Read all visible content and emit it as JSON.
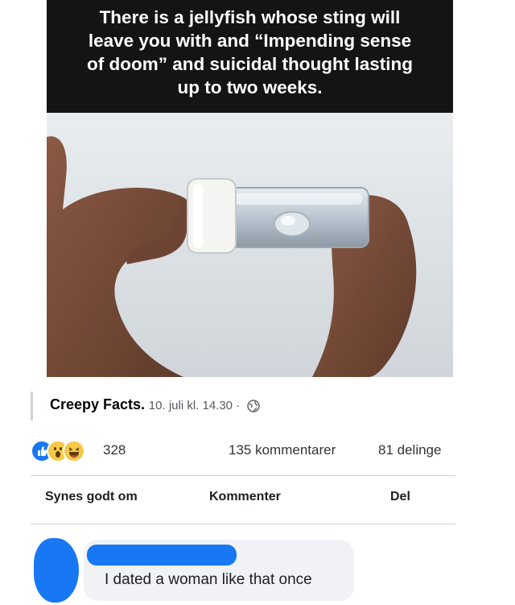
{
  "caption": {
    "lines": [
      "There is a jellyfish whose sting will",
      "leave you with and “Impending sense",
      "of doom” and suicidal thought lasting",
      "up to two weeks."
    ]
  },
  "post": {
    "page_name": "Creepy Facts.",
    "date": "10. juli kl. 14.30 ·",
    "reaction_count": "328",
    "comment_count": "135 kommentarer",
    "share_count": "81 delinge",
    "actions": {
      "like": "Synes godt om",
      "comment": "Kommenter",
      "share": "Del"
    }
  },
  "comment": {
    "text": "I dated a woman like that once"
  },
  "icons": {
    "reactions": [
      "like-icon",
      "wow-icon",
      "haha-icon"
    ],
    "privacy": "globe-icon"
  },
  "colors": {
    "caption_bg": "#141414",
    "facebook_blue": "#1877f2",
    "reaction_yellow": "#f7c948",
    "comment_bubble": "#f0f2f5"
  }
}
